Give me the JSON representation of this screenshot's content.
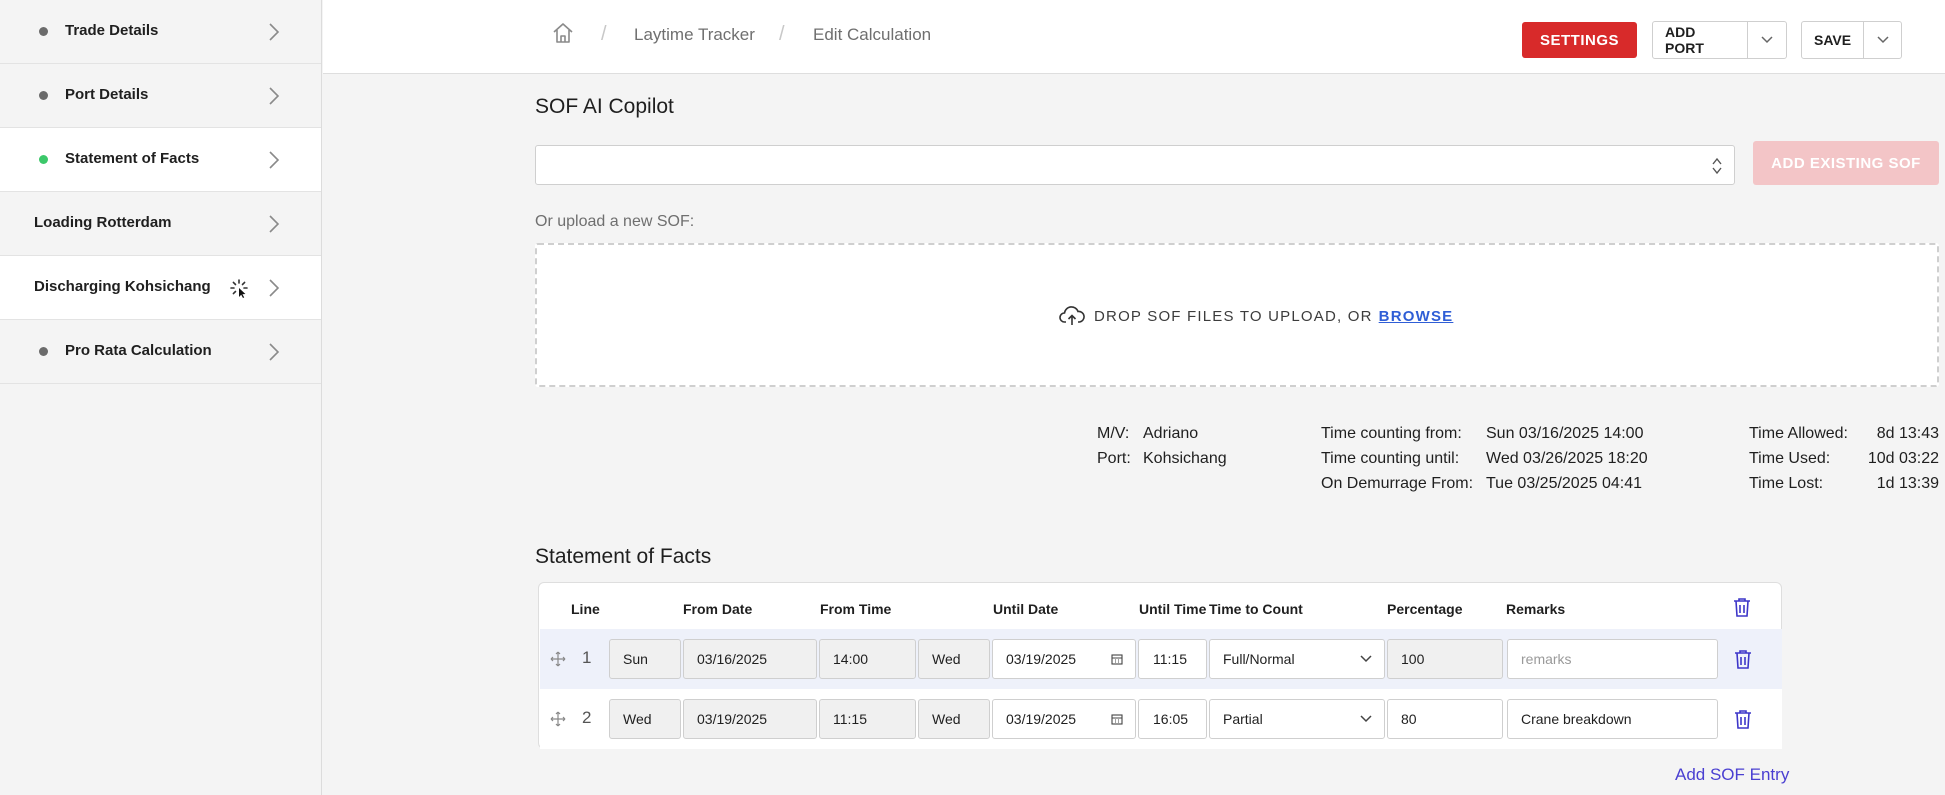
{
  "sidebar": {
    "items": [
      {
        "label": "Trade Details",
        "status": "grey"
      },
      {
        "label": "Port Details",
        "status": "grey"
      },
      {
        "label": "Statement of Facts",
        "status": "green"
      },
      {
        "label": "Loading Rotterdam",
        "status": "none"
      },
      {
        "label": "Discharging Kohsichang",
        "status": "loading"
      },
      {
        "label": "Pro Rata Calculation",
        "status": "grey"
      }
    ]
  },
  "header": {
    "breadcrumb": [
      "Laytime Tracker",
      "Edit Calculation"
    ],
    "settings_label": "SETTINGS",
    "add_port_label": "ADD PORT",
    "save_label": "SAVE"
  },
  "copilot": {
    "title": "SOF AI Copilot",
    "add_existing_label": "ADD EXISTING SOF",
    "upload_label": "Or upload a new SOF:",
    "drop_text": "DROP SOF FILES TO UPLOAD, OR",
    "browse_label": "BROWSE"
  },
  "summary": {
    "mv_label": "M/V:",
    "mv_value": "Adriano",
    "port_label": "Port:",
    "port_value": "Kohsichang",
    "from_label": "Time counting from:",
    "from_value": "Sun 03/16/2025 14:00",
    "until_label": "Time counting until:",
    "until_value": "Wed 03/26/2025 18:20",
    "demurrage_label": "On Demurrage From:",
    "demurrage_value": "Tue 03/25/2025 04:41",
    "allowed_label": "Time Allowed:",
    "allowed_value": "8d 13:43",
    "used_label": "Time Used:",
    "used_value": "10d 03:22",
    "lost_label": "Time Lost:",
    "lost_value": "1d 13:39"
  },
  "sof": {
    "title": "Statement of Facts",
    "columns": [
      "Line",
      "From Date",
      "From Time",
      "Until Date",
      "Until Time",
      "Time to Count",
      "Percentage",
      "Remarks"
    ],
    "rows": [
      {
        "line": "1",
        "from_day": "Sun",
        "from_date": "03/16/2025",
        "from_time": "14:00",
        "until_day": "Wed",
        "until_date": "03/19/2025",
        "until_time": "11:15",
        "time_to_count": "Full/Normal",
        "percentage": "100",
        "remarks_placeholder": "remarks",
        "remarks": ""
      },
      {
        "line": "2",
        "from_day": "Wed",
        "from_date": "03/19/2025",
        "from_time": "11:15",
        "until_day": "Wed",
        "until_date": "03/19/2025",
        "until_time": "16:05",
        "time_to_count": "Partial",
        "percentage": "80",
        "remarks_placeholder": "",
        "remarks": "Crane breakdown"
      }
    ],
    "add_entry_label": "Add SOF Entry"
  }
}
